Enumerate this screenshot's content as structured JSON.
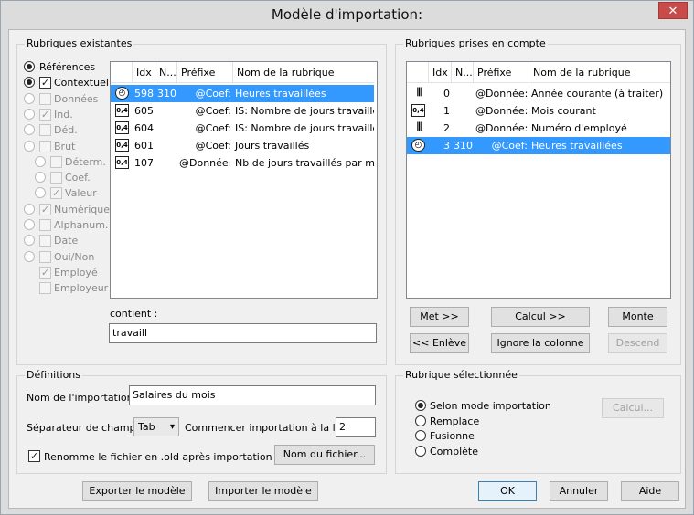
{
  "window": {
    "title": "Modèle d'importation:",
    "close_label": "✕"
  },
  "left_panel": {
    "legend": "Rubriques existantes",
    "filters": [
      {
        "label": "Références",
        "radio": "on",
        "check": null,
        "disabled": false,
        "indent": 0
      },
      {
        "label": "Contextuel",
        "radio": "on",
        "check": "checked",
        "disabled": false,
        "indent": 0
      },
      {
        "label": "Données",
        "radio": "off",
        "check": "unchecked",
        "disabled": true,
        "indent": 0
      },
      {
        "label": "Ind.",
        "radio": "off",
        "check": "checked",
        "disabled": true,
        "indent": 0
      },
      {
        "label": "Déd.",
        "radio": "off",
        "check": "unchecked",
        "disabled": true,
        "indent": 0
      },
      {
        "label": "Brut",
        "radio": "off",
        "check": "unchecked",
        "disabled": true,
        "indent": 0
      },
      {
        "label": "Déterm.",
        "radio": "off",
        "check": "unchecked",
        "disabled": true,
        "indent": 1
      },
      {
        "label": "Coef.",
        "radio": "off",
        "check": "unchecked",
        "disabled": true,
        "indent": 1
      },
      {
        "label": "Valeur",
        "radio": "off",
        "check": "checked",
        "disabled": true,
        "indent": 1
      },
      {
        "label": "Numérique",
        "radio": "off",
        "check": "checked",
        "disabled": true,
        "indent": 0
      },
      {
        "label": "Alphanum.",
        "radio": "off",
        "check": "unchecked",
        "disabled": true,
        "indent": 0
      },
      {
        "label": "Date",
        "radio": "off",
        "check": "unchecked",
        "disabled": true,
        "indent": 0
      },
      {
        "label": "Oui/Non",
        "radio": "off",
        "check": "unchecked",
        "disabled": true,
        "indent": 0
      },
      {
        "label": "Employé",
        "radio": null,
        "check": "checked",
        "disabled": true,
        "indent": 0
      },
      {
        "label": "Employeur",
        "radio": null,
        "check": "unchecked",
        "disabled": true,
        "indent": 0
      }
    ],
    "columns": [
      "Idx",
      "N...",
      "Préfixe",
      "Nom de la rubrique"
    ],
    "rows": [
      {
        "icon": "clock-icon",
        "idx": "598",
        "n": "310.",
        "prefix": "@Coef:",
        "name": "Heures travaillées",
        "selected": true
      },
      {
        "icon": "decimal-icon",
        "idx": "605",
        "n": "",
        "prefix": "@Coef:",
        "name": "IS: Nombre de jours travaillés en",
        "selected": false
      },
      {
        "icon": "decimal-icon",
        "idx": "604",
        "n": "",
        "prefix": "@Coef:",
        "name": "IS: Nombre de jours travaillés ho",
        "selected": false
      },
      {
        "icon": "decimal-icon",
        "idx": "601",
        "n": "",
        "prefix": "@Coef:",
        "name": "Jours travaillés",
        "selected": false
      },
      {
        "icon": "decimal-icon",
        "idx": "107",
        "n": "",
        "prefix": "@Donnée:",
        "name": "Nb de jours travaillés par mois",
        "selected": false
      }
    ],
    "contains_label": "contient :",
    "contains_value": "travaill"
  },
  "right_panel": {
    "legend": "Rubriques prises en compte",
    "columns": [
      "Idx",
      "N...",
      "Préfixe",
      "Nom de la rubrique"
    ],
    "rows": [
      {
        "icon": "tally-icon",
        "idx": "0",
        "n": "",
        "prefix": "@Donnée:",
        "name": "Année courante (à traiter)",
        "selected": false
      },
      {
        "icon": "decimal-icon",
        "idx": "1",
        "n": "",
        "prefix": "@Donnée:",
        "name": "Mois courant",
        "selected": false
      },
      {
        "icon": "tally-icon",
        "idx": "2",
        "n": "",
        "prefix": "@Donnée:",
        "name": "Numéro d'employé",
        "selected": false
      },
      {
        "icon": "clock-icon",
        "idx": "3",
        "n": "310.",
        "prefix": "@Coef:",
        "name": "Heures travaillées",
        "selected": true
      }
    ],
    "buttons": {
      "add": "Met >>",
      "calc": "Calcul >>",
      "up": "Monte",
      "remove": "<< Enlève",
      "ignore": "Ignore la colonne",
      "down": "Descend"
    }
  },
  "definitions": {
    "legend": "Définitions",
    "name_label": "Nom de l'importation :",
    "name_value": "Salaires du mois",
    "sep_label": "Séparateur de champs :",
    "sep_value": "Tab",
    "start_label": "Commencer importation à la ligne :",
    "start_value": "2",
    "rename_label": "Renomme le fichier en .old après importation",
    "filename_button": "Nom du fichier..."
  },
  "selected_field": {
    "legend": "Rubrique sélectionnée",
    "options": [
      {
        "label": "Selon mode importation",
        "on": true
      },
      {
        "label": "Remplace",
        "on": false
      },
      {
        "label": "Fusionne",
        "on": false
      },
      {
        "label": "Complète",
        "on": false
      }
    ],
    "calc_button": "Calcul..."
  },
  "footer": {
    "export": "Exporter le modèle",
    "import": "Importer le modèle",
    "ok": "OK",
    "cancel": "Annuler",
    "help": "Aide"
  },
  "icons": {
    "clock": "🕒",
    "decimal": "0,4",
    "tally": "𝍸"
  }
}
